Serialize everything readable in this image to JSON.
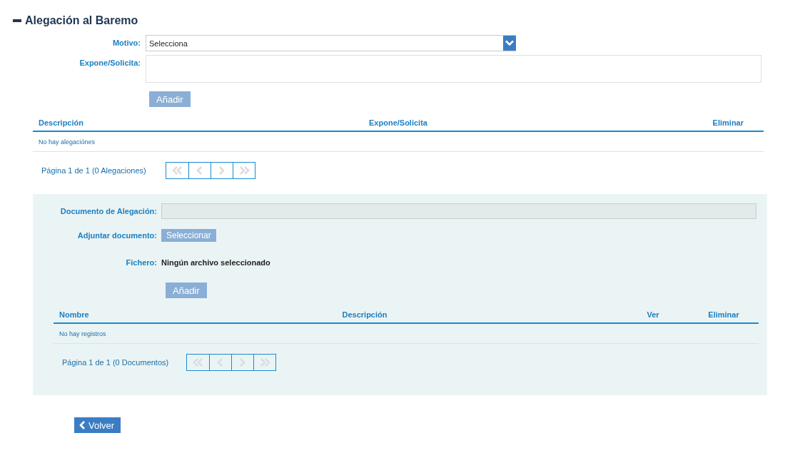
{
  "section": {
    "title": "Alegación al Baremo",
    "expanded": true
  },
  "alegacion_form": {
    "motivo": {
      "label": "Motivo:",
      "value": "Selecciona"
    },
    "expone": {
      "label": "Expone/Solicita:"
    },
    "add_button": {
      "label": "Añadir",
      "disabled": true
    }
  },
  "alegaciones_table": {
    "columns": [
      "Descripción",
      "Expone/Solicita",
      "Eliminar"
    ],
    "empty_message": "No hay alegaciónes",
    "pager": {
      "text": "Página 1 de 1 (0 Alegaciones)",
      "disabled": true
    }
  },
  "documento_panel": {
    "documento": {
      "label": "Documento de Alegación:",
      "disabled": true
    },
    "adjuntar": {
      "label": "Adjuntar documento:",
      "button": "Seleccionar",
      "disabled": true
    },
    "fichero": {
      "label": "Fichero:",
      "value": "Ningún archivo seleccionado"
    },
    "add_button": {
      "label": "Añadir",
      "disabled": true
    },
    "table": {
      "columns": [
        "Nombre",
        "Descripción",
        "Ver",
        "Eliminar"
      ],
      "empty_message": "No hay registros",
      "pager": {
        "text": "Página 1 de 1 (0 Documentos)",
        "disabled": true
      }
    }
  },
  "back_button": {
    "label": "Volver"
  }
}
